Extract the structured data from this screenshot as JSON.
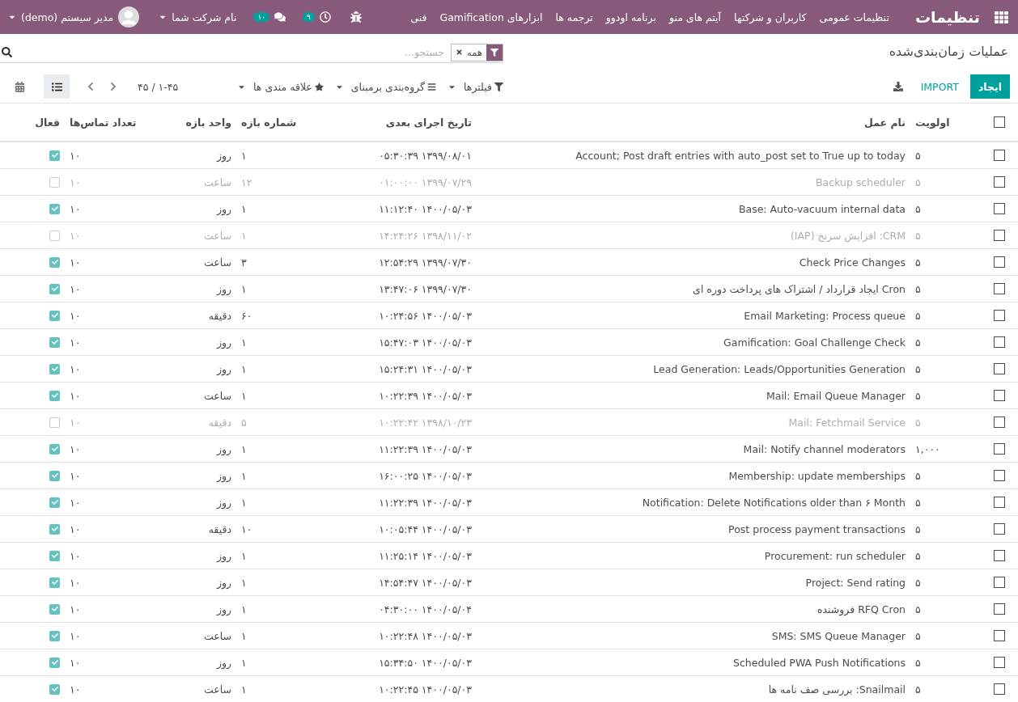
{
  "navbar": {
    "app_title": "تنظیمات",
    "menu": [
      "تنظیمات عمومی",
      "کاربران و شرکتها",
      "آیتم های منو",
      "برنامه اودوو",
      "ترجمه ها",
      "ابزارهای Gamification",
      "فنی"
    ],
    "activity_count": "۹",
    "message_count": "۱۰",
    "company": "نام شرکت شما",
    "user": "مدیر سیستم (demo)"
  },
  "control_panel": {
    "breadcrumb": "عملیات زمان‌بندی‌شده",
    "create_button": "ایجاد",
    "import_button": "IMPORT",
    "search": {
      "facet": "همه",
      "placeholder": "جستجو..."
    },
    "filters": [
      {
        "kind": "filter",
        "label": "فیلترها"
      },
      {
        "kind": "group",
        "label": "گروه‌بندی برمبنای"
      },
      {
        "kind": "favorite",
        "label": "علاقه مندی ها"
      }
    ],
    "pager": "۱-۴۵ / ۴۵",
    "views": [
      {
        "kind": "list",
        "selected": true
      },
      {
        "kind": "calendar",
        "selected": false
      }
    ]
  },
  "table": {
    "select_all": {
      "checked": false
    },
    "columns": [
      "اولویت",
      "نام عمل",
      "تاریخ اجرای بعدی",
      "شماره بازه",
      "واحد بازه",
      "تعداد تماس‌ها",
      "فعال"
    ],
    "rows": [
      {
        "selected": false,
        "priority": "۵",
        "name": "Account; Post draft entries with auto_post set to True up to today",
        "next_date": "۱۳۹۹/۰۸/۰۱ ۰۵:۳۰:۳۹",
        "interval_number": "۱",
        "interval_unit": "روز",
        "call_count": "۱۰",
        "active": true
      },
      {
        "selected": false,
        "priority": "۵",
        "name": "Backup scheduler",
        "next_date": "۱۳۹۹/۰۷/۲۹ ۰۱:۰۰:۰۰",
        "interval_number": "۱۲",
        "interval_unit": "ساعت",
        "call_count": "۱۰",
        "active": false
      },
      {
        "selected": false,
        "priority": "۵",
        "name": "Base: Auto-vacuum internal data",
        "next_date": "۱۴۰۰/۰۵/۰۳ ۱۱:۱۲:۴۰",
        "interval_number": "۱",
        "interval_unit": "روز",
        "call_count": "۱۰",
        "active": true
      },
      {
        "selected": false,
        "priority": "۵",
        "name": "CRM: افزایش سرنخ (IAP)",
        "next_date": "۱۳۹۸/۱۱/۰۲ ۱۴:۲۴:۲۶",
        "interval_number": "۱",
        "interval_unit": "ساعت",
        "call_count": "۱۰",
        "active": false
      },
      {
        "selected": false,
        "priority": "۵",
        "name": "Check Price Changes",
        "next_date": "۱۳۹۹/۰۷/۳۰ ۱۲:۵۴:۲۹",
        "interval_number": "۳",
        "interval_unit": "ساعت",
        "call_count": "۱۰",
        "active": true
      },
      {
        "selected": false,
        "priority": "۵",
        "name": "Cron ایجاد قرارداد / اشتراک های پرداخت دوره ای",
        "next_date": "۱۳۹۹/۰۷/۳۰ ۱۳:۴۷:۰۶",
        "interval_number": "۱",
        "interval_unit": "روز",
        "call_count": "۱۰",
        "active": true
      },
      {
        "selected": false,
        "priority": "۵",
        "name": "Email Marketing: Process queue",
        "next_date": "۱۴۰۰/۰۵/۰۳ ۱۰:۲۴:۵۶",
        "interval_number": "۶۰",
        "interval_unit": "دقیقه",
        "call_count": "۱۰",
        "active": true
      },
      {
        "selected": false,
        "priority": "۵",
        "name": "Gamification: Goal Challenge Check",
        "next_date": "۱۴۰۰/۰۵/۰۳ ۱۵:۴۷:۰۳",
        "interval_number": "۱",
        "interval_unit": "روز",
        "call_count": "۱۰",
        "active": true
      },
      {
        "selected": false,
        "priority": "۵",
        "name": "Lead Generation: Leads/Opportunities Generation",
        "next_date": "۱۴۰۰/۰۵/۰۳ ۱۵:۲۴:۳۱",
        "interval_number": "۱",
        "interval_unit": "روز",
        "call_count": "۱۰",
        "active": true
      },
      {
        "selected": false,
        "priority": "۵",
        "name": "Mail: Email Queue Manager",
        "next_date": "۱۴۰۰/۰۵/۰۳ ۱۰:۲۲:۳۹",
        "interval_number": "۱",
        "interval_unit": "ساعت",
        "call_count": "۱۰",
        "active": true
      },
      {
        "selected": false,
        "priority": "۵",
        "name": "Mail: Fetchmail Service",
        "next_date": "۱۳۹۸/۱۰/۲۳ ۱۰:۲۲:۴۲",
        "interval_number": "۵",
        "interval_unit": "دقیقه",
        "call_count": "۱۰",
        "active": false
      },
      {
        "selected": false,
        "priority": "۱,۰۰۰",
        "name": "Mail: Notify channel moderators",
        "next_date": "۱۴۰۰/۰۵/۰۳ ۱۱:۲۲:۳۹",
        "interval_number": "۱",
        "interval_unit": "روز",
        "call_count": "۱۰",
        "active": true
      },
      {
        "selected": false,
        "priority": "۵",
        "name": "Membership: update memberships",
        "next_date": "۱۴۰۰/۰۵/۰۳ ۱۶:۰۰:۲۵",
        "interval_number": "۱",
        "interval_unit": "روز",
        "call_count": "۱۰",
        "active": true
      },
      {
        "selected": false,
        "priority": "۵",
        "name": "Notification: Delete Notifications older than ۶ Month",
        "next_date": "۱۴۰۰/۰۵/۰۳ ۱۱:۲۲:۳۹",
        "interval_number": "۱",
        "interval_unit": "روز",
        "call_count": "۱۰",
        "active": true
      },
      {
        "selected": false,
        "priority": "۵",
        "name": "Post process payment transactions",
        "next_date": "۱۴۰۰/۰۵/۰۳ ۱۰:۰۵:۴۴",
        "interval_number": "۱۰",
        "interval_unit": "دقیقه",
        "call_count": "۱۰",
        "active": true
      },
      {
        "selected": false,
        "priority": "۵",
        "name": "Procurement: run scheduler",
        "next_date": "۱۴۰۰/۰۵/۰۳ ۱۱:۲۵:۱۴",
        "interval_number": "۱",
        "interval_unit": "روز",
        "call_count": "۱۰",
        "active": true
      },
      {
        "selected": false,
        "priority": "۵",
        "name": "Project: Send rating",
        "next_date": "۱۴۰۰/۰۵/۰۳ ۱۴:۵۴:۴۷",
        "interval_number": "۱",
        "interval_unit": "روز",
        "call_count": "۱۰",
        "active": true
      },
      {
        "selected": false,
        "priority": "۵",
        "name": "RFQ Cron فروشنده",
        "next_date": "۱۴۰۰/۰۵/۰۴ ۰۴:۳۰:۰۰",
        "interval_number": "۱",
        "interval_unit": "روز",
        "call_count": "۱۰",
        "active": true
      },
      {
        "selected": false,
        "priority": "۵",
        "name": "SMS: SMS Queue Manager",
        "next_date": "۱۴۰۰/۰۵/۰۳ ۱۰:۲۲:۴۸",
        "interval_number": "۱",
        "interval_unit": "ساعت",
        "call_count": "۱۰",
        "active": true
      },
      {
        "selected": false,
        "priority": "۵",
        "name": "Scheduled PWA Push Notifications",
        "next_date": "۱۴۰۰/۰۵/۰۳ ۱۵:۳۴:۵۰",
        "interval_number": "۱",
        "interval_unit": "روز",
        "call_count": "۱۰",
        "active": true
      },
      {
        "selected": false,
        "priority": "۵",
        "name": "Snailmail: بررسی صف نامه ها",
        "next_date": "۱۴۰۰/۰۵/۰۳ ۱۰:۲۲:۴۵",
        "interval_number": "۱",
        "interval_unit": "ساعت",
        "call_count": "۱۰",
        "active": true
      }
    ]
  }
}
